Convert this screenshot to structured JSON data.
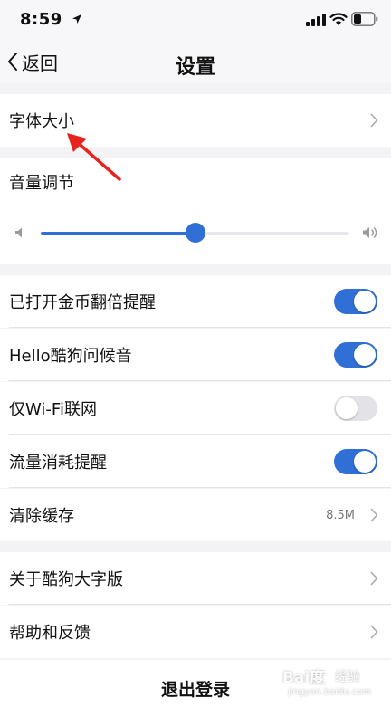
{
  "status_bar": {
    "time": "8:59"
  },
  "nav": {
    "back_label": "返回",
    "title": "设置"
  },
  "font_size": {
    "label": "字体大小"
  },
  "volume": {
    "label": "音量调节",
    "level": 0.5
  },
  "toggles": [
    {
      "label": "已打开金币翻倍提醒",
      "on": true
    },
    {
      "label": "Hello酷狗问候音",
      "on": true
    },
    {
      "label": "仅Wi-Fi联网",
      "on": false
    },
    {
      "label": "流量消耗提醒",
      "on": true
    }
  ],
  "clear_cache": {
    "label": "清除缓存",
    "value": "8.5M"
  },
  "about": {
    "label": "关于酷狗大字版"
  },
  "help": {
    "label": "帮助和反馈"
  },
  "logout": {
    "label": "退出登录"
  },
  "watermark": {
    "logo": "Bai度",
    "text": "经验",
    "url": "jingyan.baidu.com"
  },
  "colors": {
    "accent": "#2f6fd6",
    "annotation": "#e8231f"
  }
}
